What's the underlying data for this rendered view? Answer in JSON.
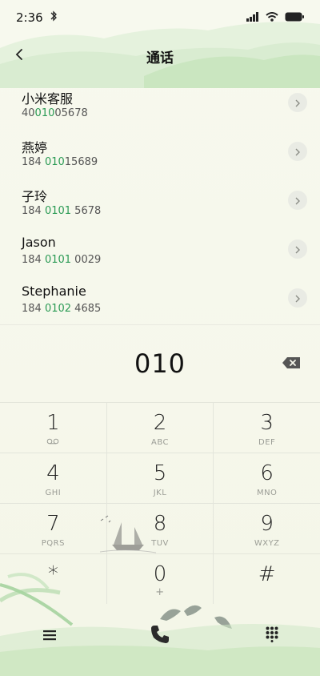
{
  "status": {
    "time": "2:36"
  },
  "header": {
    "title": "通话"
  },
  "contacts": [
    {
      "name": "小米客服",
      "num_pre": "40",
      "num_hl": "010",
      "num_post": "05678"
    },
    {
      "name": "燕婷",
      "num_pre": "184 ",
      "num_hl": "010",
      "num_post": "15689"
    },
    {
      "name": "子玲",
      "num_pre": "184 ",
      "num_hl": "0101",
      "num_post": " 5678"
    },
    {
      "name": "Jason",
      "num_pre": "184 ",
      "num_hl": "0101",
      "num_post": " 0029"
    },
    {
      "name": "Stephanie",
      "num_pre": "184 ",
      "num_hl": "0102",
      "num_post": " 4685"
    }
  ],
  "dial": {
    "value": "010"
  },
  "keypad": [
    [
      {
        "digit": "1",
        "letters": ""
      },
      {
        "digit": "2",
        "letters": "ABC"
      },
      {
        "digit": "3",
        "letters": "DEF"
      }
    ],
    [
      {
        "digit": "4",
        "letters": "GHI"
      },
      {
        "digit": "5",
        "letters": "JKL"
      },
      {
        "digit": "6",
        "letters": "MNO"
      }
    ],
    [
      {
        "digit": "7",
        "letters": "PQRS"
      },
      {
        "digit": "8",
        "letters": "TUV"
      },
      {
        "digit": "9",
        "letters": "WXYZ"
      }
    ],
    [
      {
        "digit": "*",
        "letters": ""
      },
      {
        "digit": "0",
        "letters": "+"
      },
      {
        "digit": "#",
        "letters": ""
      }
    ]
  ],
  "colors": {
    "accent": "#2a9a54",
    "call_icon": "#2b2b2b"
  }
}
